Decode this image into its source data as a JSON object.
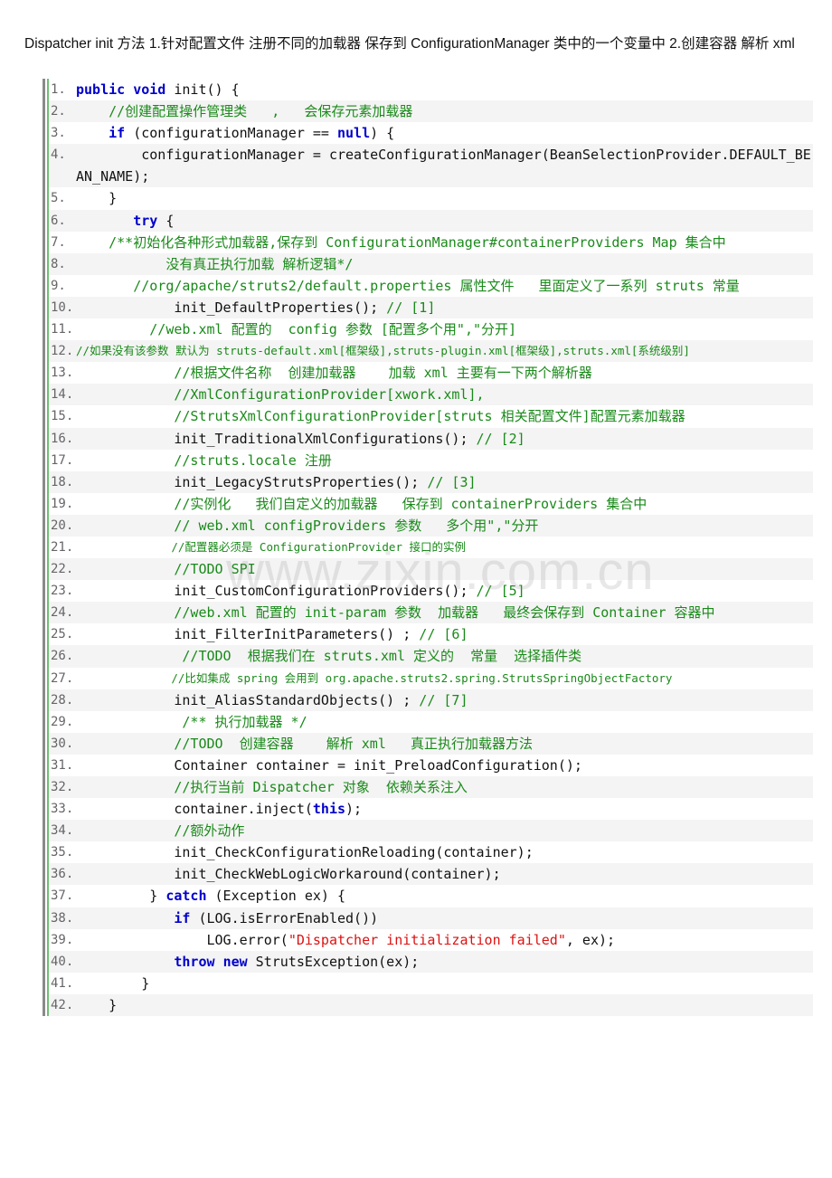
{
  "intro_text": "Dispatcher init 方法  1.针对配置文件  注册不同的加载器  保存到 ConfigurationManager 类中的一个变量中  2.创建容器  解析 xml",
  "watermark": "www.zixin.com.cn",
  "code_lines": [
    {
      "n": "1.",
      "tokens": [
        {
          "t": "kw",
          "v": "public"
        },
        {
          "t": "pl",
          "v": " "
        },
        {
          "t": "kw",
          "v": "void"
        },
        {
          "t": "pl",
          "v": " init() {"
        }
      ]
    },
    {
      "n": "2.",
      "tokens": [
        {
          "t": "pl",
          "v": "    "
        },
        {
          "t": "cm",
          "v": "//创建配置操作管理类   ,   会保存元素加载器"
        }
      ]
    },
    {
      "n": "3.",
      "tokens": [
        {
          "t": "pl",
          "v": "    "
        },
        {
          "t": "kw",
          "v": "if"
        },
        {
          "t": "pl",
          "v": " (configurationManager == "
        },
        {
          "t": "kw",
          "v": "null"
        },
        {
          "t": "pl",
          "v": ") {"
        }
      ]
    },
    {
      "n": "4.",
      "tall": true,
      "tokens": [
        {
          "t": "pl",
          "v": "        configurationManager = createConfigurationManager(BeanSelectionProvider.DEFAULT_BEAN_NAME);"
        }
      ]
    },
    {
      "n": "5.",
      "tokens": [
        {
          "t": "pl",
          "v": "    }"
        }
      ]
    },
    {
      "n": "6.",
      "tokens": [
        {
          "t": "pl",
          "v": "       "
        },
        {
          "t": "kw",
          "v": "try"
        },
        {
          "t": "pl",
          "v": " {"
        }
      ]
    },
    {
      "n": "7.",
      "tokens": [
        {
          "t": "pl",
          "v": "    "
        },
        {
          "t": "cm",
          "v": "/**初始化各种形式加载器,保存到 ConfigurationManager#containerProviders Map 集合中"
        }
      ]
    },
    {
      "n": "8.",
      "tokens": [
        {
          "t": "cm",
          "v": "           没有真正执行加载 解析逻辑*/"
        }
      ]
    },
    {
      "n": "9.",
      "tokens": [
        {
          "t": "pl",
          "v": "       "
        },
        {
          "t": "cm",
          "v": "//org/apache/struts2/default.properties 属性文件   里面定义了一系列 struts 常量"
        }
      ]
    },
    {
      "n": "10.",
      "tokens": [
        {
          "t": "pl",
          "v": "            init_DefaultProperties(); "
        },
        {
          "t": "cm",
          "v": "// [1]"
        }
      ]
    },
    {
      "n": "11.",
      "tokens": [
        {
          "t": "pl",
          "v": "         "
        },
        {
          "t": "cm",
          "v": "//web.xml 配置的  config 参数 [配置多个用\",\"分开]"
        }
      ]
    },
    {
      "n": "12.",
      "small": true,
      "tokens": [
        {
          "t": "cm",
          "v": "//如果没有该参数 默认为 struts-default.xml[框架级],struts-plugin.xml[框架级],struts.xml[系统级别]"
        }
      ]
    },
    {
      "n": "13.",
      "tokens": [
        {
          "t": "pl",
          "v": "            "
        },
        {
          "t": "cm",
          "v": "//根据文件名称  创建加载器    加载 xml 主要有一下两个解析器"
        }
      ]
    },
    {
      "n": "14.",
      "tokens": [
        {
          "t": "pl",
          "v": "            "
        },
        {
          "t": "cm",
          "v": "//XmlConfigurationProvider[xwork.xml],"
        }
      ]
    },
    {
      "n": "15.",
      "tokens": [
        {
          "t": "pl",
          "v": "            "
        },
        {
          "t": "cm",
          "v": "//StrutsXmlConfigurationProvider[struts 相关配置文件]配置元素加载器"
        }
      ]
    },
    {
      "n": "16.",
      "tokens": [
        {
          "t": "pl",
          "v": "            init_TraditionalXmlConfigurations(); "
        },
        {
          "t": "cm",
          "v": "// [2]"
        }
      ]
    },
    {
      "n": "17.",
      "tokens": [
        {
          "t": "pl",
          "v": "            "
        },
        {
          "t": "cm",
          "v": "//struts.locale 注册"
        }
      ]
    },
    {
      "n": "18.",
      "tokens": [
        {
          "t": "pl",
          "v": "            init_LegacyStrutsProperties(); "
        },
        {
          "t": "cm",
          "v": "// [3]"
        }
      ]
    },
    {
      "n": "19.",
      "tokens": [
        {
          "t": "pl",
          "v": "            "
        },
        {
          "t": "cm",
          "v": "//实例化   我们自定义的加载器   保存到 containerProviders 集合中"
        }
      ]
    },
    {
      "n": "20.",
      "tokens": [
        {
          "t": "pl",
          "v": "            "
        },
        {
          "t": "cm",
          "v": "// web.xml configProviders 参数   多个用\",\"分开"
        }
      ]
    },
    {
      "n": "21.",
      "small": true,
      "tokens": [
        {
          "t": "pl",
          "v": "              "
        },
        {
          "t": "cm",
          "v": "//配置器必须是 ConfigurationProvider 接口的实例"
        }
      ]
    },
    {
      "n": "22.",
      "tokens": [
        {
          "t": "pl",
          "v": "            "
        },
        {
          "t": "cm",
          "v": "//TODO SPI"
        }
      ]
    },
    {
      "n": "23.",
      "tokens": [
        {
          "t": "pl",
          "v": "            init_CustomConfigurationProviders(); "
        },
        {
          "t": "cm",
          "v": "// [5]"
        }
      ]
    },
    {
      "n": "24.",
      "tokens": [
        {
          "t": "pl",
          "v": "            "
        },
        {
          "t": "cm",
          "v": "//web.xml 配置的 init-param 参数  加载器   最终会保存到 Container 容器中"
        }
      ]
    },
    {
      "n": "25.",
      "tokens": [
        {
          "t": "pl",
          "v": "            init_FilterInitParameters() ; "
        },
        {
          "t": "cm",
          "v": "// [6]"
        }
      ]
    },
    {
      "n": "26.",
      "tokens": [
        {
          "t": "pl",
          "v": "             "
        },
        {
          "t": "cm",
          "v": "//TODO  根据我们在 struts.xml 定义的  常量  选择插件类"
        }
      ]
    },
    {
      "n": "27.",
      "small": true,
      "tokens": [
        {
          "t": "pl",
          "v": "              "
        },
        {
          "t": "cm",
          "v": "//比如集成 spring 会用到 org.apache.struts2.spring.StrutsSpringObjectFactory"
        }
      ]
    },
    {
      "n": "28.",
      "tokens": [
        {
          "t": "pl",
          "v": "            init_AliasStandardObjects() ; "
        },
        {
          "t": "cm",
          "v": "// [7]"
        }
      ]
    },
    {
      "n": "29.",
      "tokens": [
        {
          "t": "pl",
          "v": "             "
        },
        {
          "t": "cm",
          "v": "/** 执行加载器 */"
        }
      ]
    },
    {
      "n": "30.",
      "tokens": [
        {
          "t": "pl",
          "v": "            "
        },
        {
          "t": "cm",
          "v": "//TODO  创建容器    解析 xml   真正执行加载器方法"
        }
      ]
    },
    {
      "n": "31.",
      "tokens": [
        {
          "t": "pl",
          "v": "            Container container = init_PreloadConfiguration();"
        }
      ]
    },
    {
      "n": "32.",
      "tokens": [
        {
          "t": "pl",
          "v": "            "
        },
        {
          "t": "cm",
          "v": "//执行当前 Dispatcher 对象  依赖关系注入"
        }
      ]
    },
    {
      "n": "33.",
      "tokens": [
        {
          "t": "pl",
          "v": "            container.inject("
        },
        {
          "t": "kw",
          "v": "this"
        },
        {
          "t": "pl",
          "v": ");"
        }
      ]
    },
    {
      "n": "34.",
      "tokens": [
        {
          "t": "pl",
          "v": "            "
        },
        {
          "t": "cm",
          "v": "//额外动作"
        }
      ]
    },
    {
      "n": "35.",
      "tokens": [
        {
          "t": "pl",
          "v": "            init_CheckConfigurationReloading(container);"
        }
      ]
    },
    {
      "n": "36.",
      "tokens": [
        {
          "t": "pl",
          "v": "            init_CheckWebLogicWorkaround(container);"
        }
      ]
    },
    {
      "n": "37.",
      "tokens": [
        {
          "t": "pl",
          "v": "         } "
        },
        {
          "t": "kw",
          "v": "catch"
        },
        {
          "t": "pl",
          "v": " (Exception ex) {"
        }
      ]
    },
    {
      "n": "38.",
      "tokens": [
        {
          "t": "pl",
          "v": "            "
        },
        {
          "t": "kw",
          "v": "if"
        },
        {
          "t": "pl",
          "v": " (LOG.isErrorEnabled())"
        }
      ]
    },
    {
      "n": "39.",
      "tokens": [
        {
          "t": "pl",
          "v": "                LOG.error("
        },
        {
          "t": "st",
          "v": "\"Dispatcher initialization failed\""
        },
        {
          "t": "pl",
          "v": ", ex);"
        }
      ]
    },
    {
      "n": "40.",
      "tokens": [
        {
          "t": "pl",
          "v": "            "
        },
        {
          "t": "kw",
          "v": "throw"
        },
        {
          "t": "pl",
          "v": " "
        },
        {
          "t": "kw",
          "v": "new"
        },
        {
          "t": "pl",
          "v": " StrutsException(ex);"
        }
      ]
    },
    {
      "n": "41.",
      "tokens": [
        {
          "t": "pl",
          "v": "        }"
        }
      ]
    },
    {
      "n": "42.",
      "tokens": [
        {
          "t": "pl",
          "v": "    }"
        }
      ]
    }
  ]
}
